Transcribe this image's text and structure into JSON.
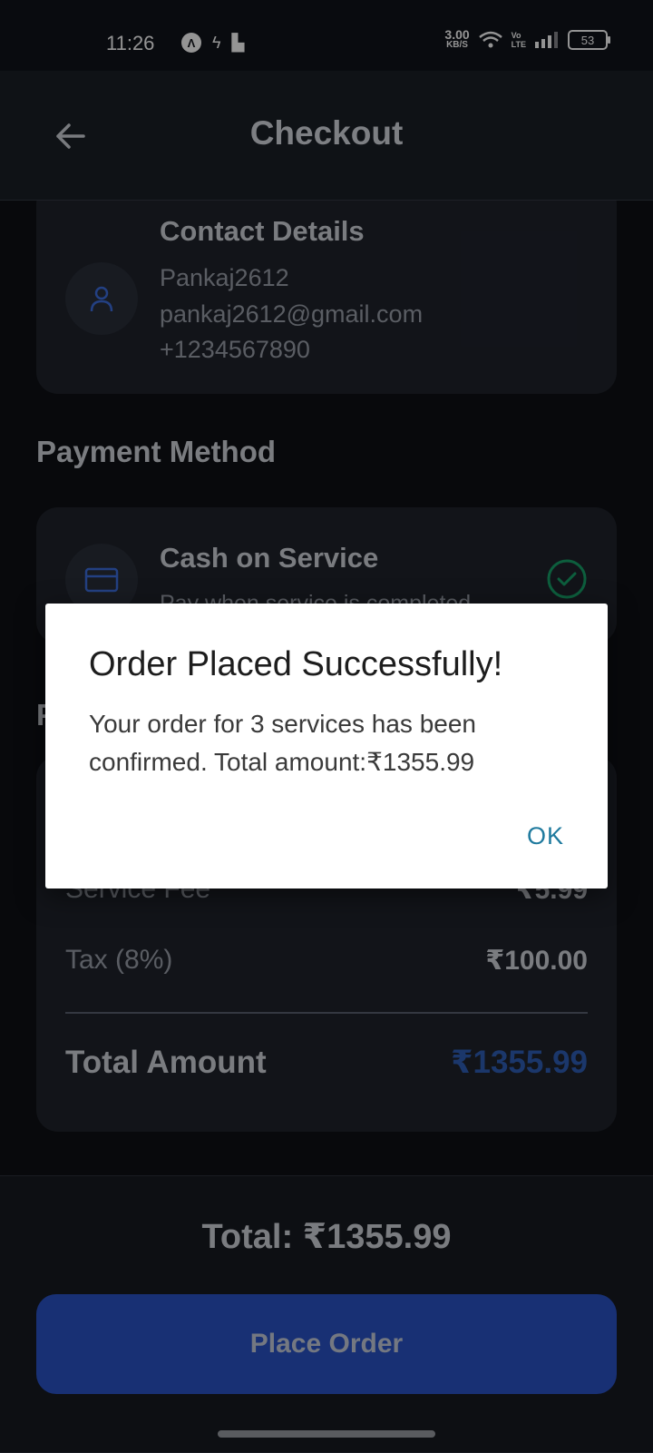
{
  "status_bar": {
    "time": "11:26",
    "net_speed_value": "3.00",
    "net_speed_unit": "KB/S",
    "volte_top": "Vo",
    "volte_bottom": "LTE",
    "battery": "53"
  },
  "app_bar": {
    "title": "Checkout",
    "back_icon": "arrow-left-icon"
  },
  "contact": {
    "title": "Contact Details",
    "name": "Pankaj2612",
    "email": "pankaj2612@gmail.com",
    "phone": "+1234567890",
    "icon": "person-icon"
  },
  "payment": {
    "section_title": "Payment Method",
    "method_title": "Cash on Service",
    "method_subtitle": "Pay when service is completed",
    "icon": "credit-card-icon",
    "selected_icon": "check-circle-icon"
  },
  "summary": {
    "rows": [
      {
        "label": "Service Fee",
        "amount": "₹5.99"
      },
      {
        "label": "Tax (8%)",
        "amount": "₹100.00"
      }
    ],
    "total_label": "Total Amount",
    "total_amount": "₹1355.99"
  },
  "bottom": {
    "total_text": "Total: ₹1355.99",
    "place_order_label": "Place Order"
  },
  "dialog": {
    "title": "Order Placed Successfully!",
    "message": "Your order for 3 services has been confirmed. Total amount:₹1355.99",
    "ok_label": "OK"
  },
  "colors": {
    "accent": "#2a54c9",
    "total_amount": "#2f5fb8",
    "check": "#17a36a",
    "dialog_button": "#1f7a9e"
  }
}
